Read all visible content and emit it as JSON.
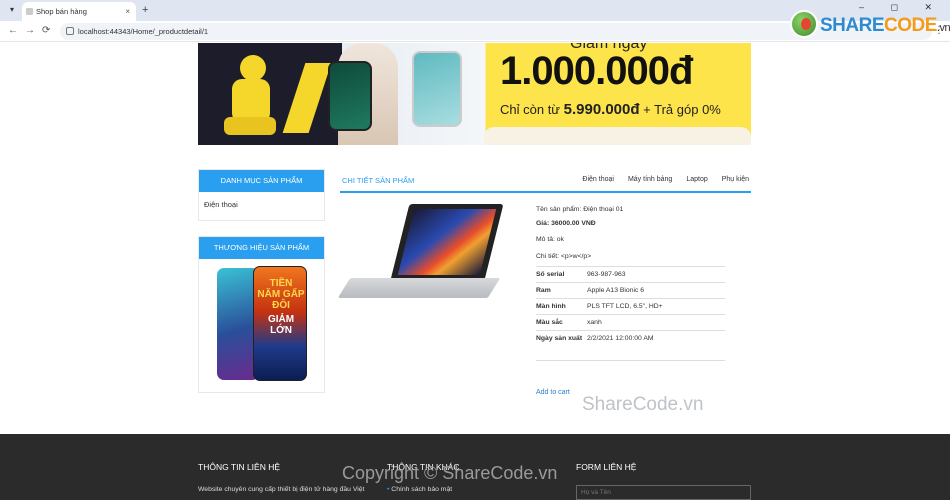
{
  "browser": {
    "tab_title": "Shop bán hàng",
    "tab_close": "×",
    "new_tab": "+",
    "url": "localhost:44343/Home/_productdetail/1",
    "back": "←",
    "forward": "→",
    "reload": "⟳",
    "menu": "⋮",
    "tab_menu": "▾",
    "window_controls": "– ◻ ✕"
  },
  "sharecode": {
    "brand_a": "SHARE",
    "brand_b": "CODE",
    "domain": ".vn",
    "watermark": "ShareCode.vn",
    "footer_watermark": "Copyright © ShareCode.vn"
  },
  "banner": {
    "top_text": "Giảm ngay",
    "big_text": "1.000.000đ",
    "sub_prefix": "Chỉ còn từ",
    "sub_price": "5.990.000đ",
    "sub_suffix": "+ Trả góp 0%"
  },
  "sidebar": {
    "categories_title": "DANH MỤC SẢN PHẨM",
    "categories": [
      "Điện thoại"
    ],
    "brands_title": "THƯƠNG HIỆU SẢN PHẨM",
    "brand_promo_line1": "TIỀN NĂM GẤP ĐÔI",
    "brand_promo_line2": "GIẢM LỚN"
  },
  "detail": {
    "title": "CHI TIẾT SẢN PHẨM",
    "tabs": [
      "Điện thoại",
      "Máy tính bảng",
      "Laptop",
      "Phụ kiện"
    ],
    "name_line": "Tên sản phẩm: Điện thoại 01",
    "price_line": "Giá: 36000.00 VNĐ",
    "desc_line": "Mô tả: ok",
    "detail_line": "Chi tiết: <p>w</p>",
    "specs": [
      {
        "label": "Số serial",
        "value": "963-987-963"
      },
      {
        "label": "Ram",
        "value": "Apple A13 Bionic 6"
      },
      {
        "label": "Màn hình",
        "value": "PLS TFT LCD, 6.5\", HD+"
      },
      {
        "label": "Màu sắc",
        "value": "xanh"
      },
      {
        "label": "Ngày sản xuất",
        "value": "2/2/2021 12:00:00 AM"
      }
    ],
    "add_to_cart": "Add to cart"
  },
  "footer": {
    "contact_title": "THÔNG TIN LIÊN HỆ",
    "contact_text": "Website chuyên cung cấp thiết bị điện tử hàng đầu Việt",
    "info_title": "THÔNG TIN KHÁC",
    "info_item": "Chính sách bảo mật",
    "form_title": "FORM LIÊN HỆ",
    "name_placeholder": "Họ và Tên"
  },
  "colors": {
    "accent": "#2a9ff0",
    "footer_bg": "#2b2b2b",
    "link": "#2a7ec9"
  }
}
